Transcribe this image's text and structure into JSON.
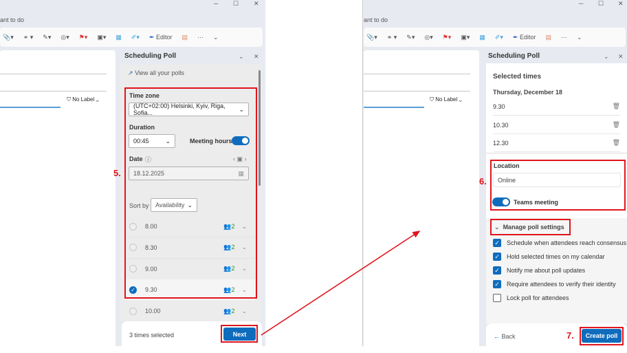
{
  "window_controls": {
    "minimize": "─",
    "maximize": "☐",
    "close": "✕"
  },
  "search_hint": "ant to do",
  "toolbar": {
    "attach": "📎▾",
    "link": "⚭ ▾",
    "signature": "✎▾",
    "loop": "◎▾",
    "flag": "⚑▾",
    "sensitivity": "▣▾",
    "apps": "▦",
    "addin": "✐▾",
    "editor_label": "Editor",
    "poll_icon": "▤",
    "more": "···",
    "expand": "⌄"
  },
  "compose": {
    "label": "No Label"
  },
  "left_pane": {
    "title": "Scheduling Poll",
    "view_polls": "View all your polls",
    "time_zone_label": "Time zone",
    "time_zone_value": "(UTC+02:00) Helsinki, Kyiv, Riga, Sofia...",
    "duration_label": "Duration",
    "duration_value": "00:45",
    "meeting_hours_label": "Meeting hours",
    "meeting_hours_on": true,
    "date_label": "Date",
    "date_value": "18.12.2025",
    "sort_by_label": "Sort by",
    "sort_by_value": "Availability",
    "slots": [
      {
        "time": "8.00",
        "attendees": "2",
        "selected": false
      },
      {
        "time": "8.30",
        "attendees": "2",
        "selected": false
      },
      {
        "time": "9.00",
        "attendees": "2",
        "selected": false
      },
      {
        "time": "9.30",
        "attendees": "2",
        "selected": true
      },
      {
        "time": "10.00",
        "attendees": "2",
        "selected": false
      }
    ],
    "selected_count": "3 times selected",
    "next": "Next"
  },
  "right_pane": {
    "title": "Scheduling Poll",
    "selected_times_heading": "Selected times",
    "day": "Thursday, December 18",
    "times": [
      "9.30",
      "10.30",
      "12.30"
    ],
    "location_label": "Location",
    "location_value": "Online",
    "teams_label": "Teams meeting",
    "teams_on": true,
    "manage_label": "Manage poll settings",
    "settings": [
      {
        "label": "Schedule when attendees reach consensus",
        "checked": true
      },
      {
        "label": "Hold selected times on my calendar",
        "checked": true
      },
      {
        "label": "Notify me about poll updates",
        "checked": true
      },
      {
        "label": "Require attendees to verify their identity",
        "checked": true
      },
      {
        "label": "Lock poll for attendees",
        "checked": false
      }
    ],
    "back": "Back",
    "create": "Create poll"
  },
  "annotations": {
    "step5": "5.",
    "step6": "6.",
    "step7": "7."
  },
  "colors": {
    "accent": "#0f6cbd",
    "annotation": "#e0141c"
  }
}
